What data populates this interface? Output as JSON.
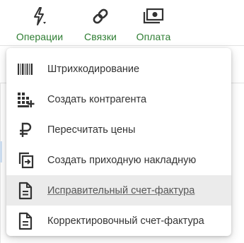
{
  "toolbar": {
    "buttons": [
      {
        "label": "Операции",
        "icon": "bolt-icon"
      },
      {
        "label": "Связки",
        "icon": "link-icon"
      },
      {
        "label": "Оплата",
        "icon": "payment-icon"
      }
    ]
  },
  "menu": {
    "items": [
      {
        "label": "Штрихкодирование",
        "icon": "barcode-icon"
      },
      {
        "label": "Создать контрагента",
        "icon": "add-building-icon"
      },
      {
        "label": "Пересчитать цены",
        "icon": "ruble-icon"
      },
      {
        "label": "Создать приходную накладную",
        "icon": "incoming-document-icon"
      },
      {
        "label": "Исправительный счет-фактура",
        "icon": "document-icon"
      },
      {
        "label": "Корректировочный счет-фактура",
        "icon": "document-icon"
      }
    ],
    "active_item": "Исправительный счет-фактура"
  },
  "colors": {
    "toolbar_label": "#2e7d32",
    "icon": "#333333",
    "active_background": "#ebebeb"
  }
}
